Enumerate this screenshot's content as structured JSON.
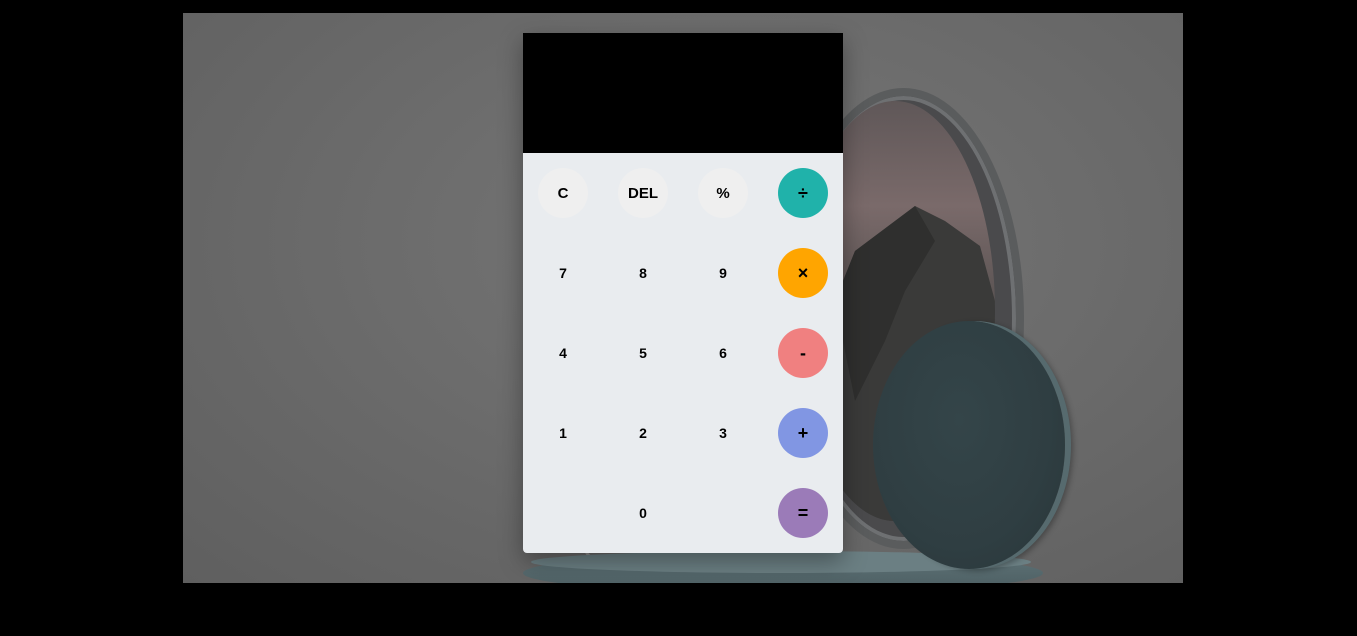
{
  "display": {
    "value": ""
  },
  "keys": {
    "clear": "C",
    "delete": "DEL",
    "percent": "%",
    "divide": "÷",
    "seven": "7",
    "eight": "8",
    "nine": "9",
    "multiply": "×",
    "four": "4",
    "five": "5",
    "six": "6",
    "subtract": "-",
    "one": "1",
    "two": "2",
    "three": "3",
    "add": "+",
    "zero": "0",
    "equals": "="
  },
  "colors": {
    "display_bg": "#000000",
    "keypad_bg": "#e9ecef",
    "divide": "#20b2aa",
    "multiply": "#ffa500",
    "subtract": "#f08080",
    "add": "#8196e3",
    "equals": "#9b7bb8"
  }
}
